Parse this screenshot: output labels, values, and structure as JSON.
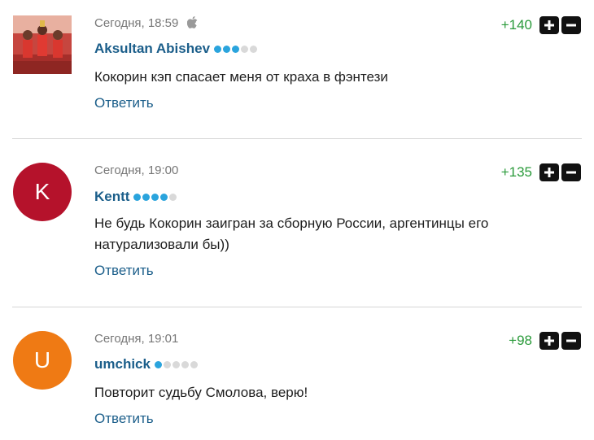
{
  "comments": [
    {
      "timestamp": "Сегодня, 18:59",
      "device_icon": "apple-icon",
      "author": "Aksultan Abishev",
      "rating_level": 3,
      "rating_max": 5,
      "text": "Кокорин кэп спасает меня от краха в фэнтези",
      "reply_label": "Ответить",
      "score": "+140",
      "avatar_type": "photo"
    },
    {
      "timestamp": "Сегодня, 19:00",
      "author": "Kentt",
      "rating_level": 4,
      "rating_max": 5,
      "text": "Не будь Кокорин заигран за сборную России, аргентинцы его натурализовали бы))",
      "reply_label": "Ответить",
      "score": "+135",
      "avatar_type": "letter",
      "avatar_letter": "K",
      "avatar_color": "#b5122b"
    },
    {
      "timestamp": "Сегодня, 19:01",
      "author": "umchick",
      "rating_level": 1,
      "rating_max": 5,
      "text": "Повторит судьбу Смолова, верю!",
      "reply_label": "Ответить",
      "score": "+98",
      "avatar_type": "letter",
      "avatar_letter": "U",
      "avatar_color": "#ef7a14"
    }
  ],
  "colors": {
    "author": "#1b5e8a",
    "score": "#2a9a3a",
    "dot_on": "#2aa4dd",
    "dot_off": "#d9d9d9"
  }
}
